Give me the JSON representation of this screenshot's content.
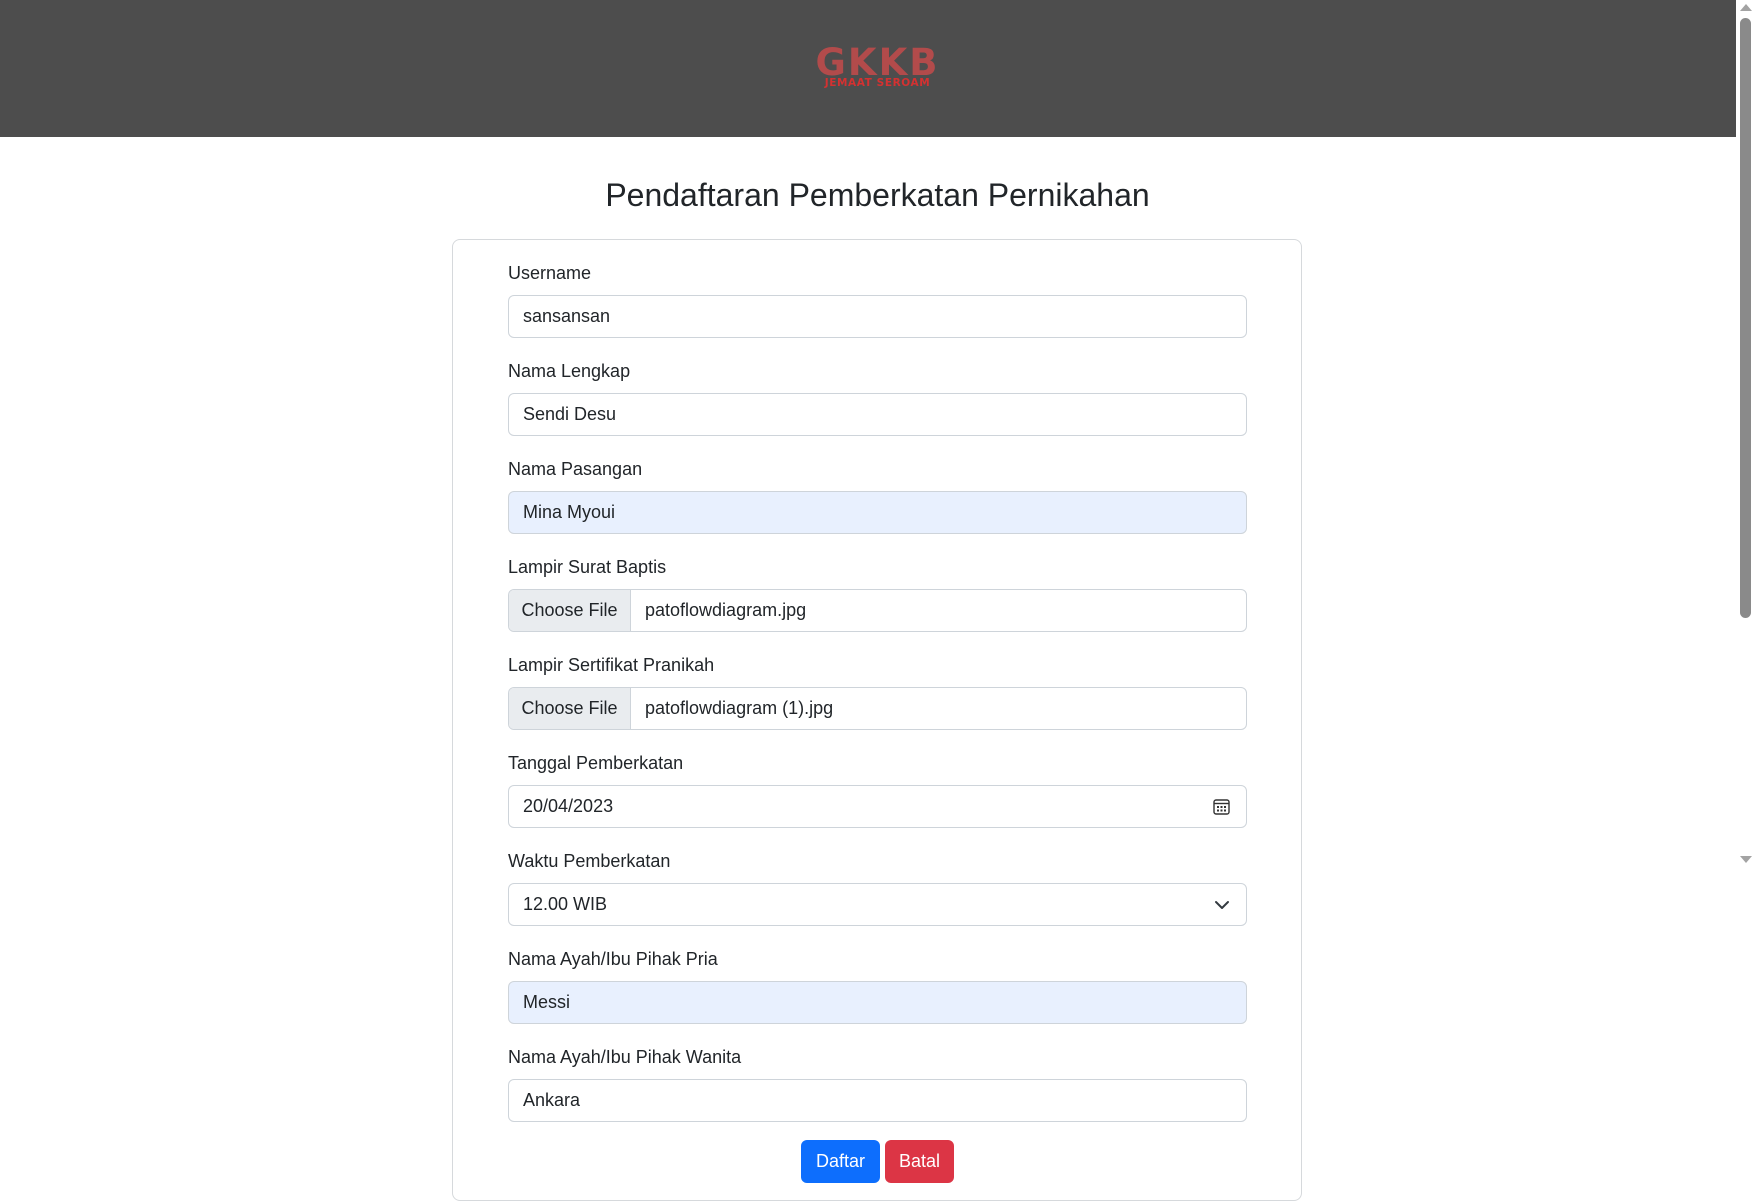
{
  "header": {
    "logo_text": "GKKB",
    "logo_subtext": "JEMAAT SEROAM"
  },
  "page": {
    "title": "Pendaftaran Pemberkatan Pernikahan"
  },
  "form": {
    "username": {
      "label": "Username",
      "value": "sansansan"
    },
    "nama_lengkap": {
      "label": "Nama Lengkap",
      "value": "Sendi Desu"
    },
    "nama_pasangan": {
      "label": "Nama Pasangan",
      "value": "Mina Myoui"
    },
    "surat_baptis": {
      "label": "Lampir Surat Baptis",
      "button": "Choose File",
      "filename": "patoflowdiagram.jpg"
    },
    "sertifikat_pranikah": {
      "label": "Lampir Sertifikat Pranikah",
      "button": "Choose File",
      "filename": "patoflowdiagram (1).jpg"
    },
    "tanggal": {
      "label": "Tanggal Pemberkatan",
      "value": "20/04/2023",
      "icon": "calendar-icon"
    },
    "waktu": {
      "label": "Waktu Pemberkatan",
      "value": "12.00 WIB",
      "icon": "chevron-down-icon"
    },
    "ortu_pria": {
      "label": "Nama Ayah/Ibu Pihak Pria",
      "value": "Messi"
    },
    "ortu_wanita": {
      "label": "Nama Ayah/Ibu Pihak Wanita",
      "value": "Ankara"
    },
    "submit_label": "Daftar",
    "cancel_label": "Batal"
  },
  "colors": {
    "header_bg": "#4d4d4d",
    "primary": "#0d6efd",
    "danger": "#dc3545",
    "autofill": "#e8f0fe"
  }
}
